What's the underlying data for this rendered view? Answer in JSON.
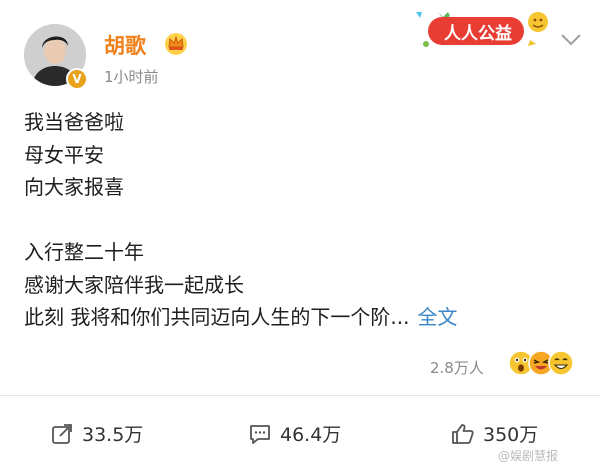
{
  "post": {
    "author": "胡歌",
    "time": "1小时前",
    "verified_mark": "V",
    "charity_label": "人人公益",
    "lines": [
      "我当爸爸啦",
      "母女平安",
      "向大家报喜",
      "",
      "入行整二十年",
      "感谢大家陪伴我一起成长"
    ],
    "last_line": "此刻 我将和你们共同迈向人生的下一个阶...",
    "full_text_link": "全文",
    "reaction_count": "2.8万人"
  },
  "actions": {
    "repost": "33.5万",
    "comment": "46.4万",
    "like": "350万"
  },
  "watermark": "@娱剧慧报",
  "colors": {
    "username": "#f0801a",
    "link": "#3a86c8",
    "badge": "#e8a21c",
    "charity_badge": "#e83d33"
  },
  "icons": {
    "crown": "crown-icon",
    "chevron": "chevron-down-icon",
    "repost": "repost-icon",
    "comment": "comment-icon",
    "like": "thumbs-up-icon"
  }
}
